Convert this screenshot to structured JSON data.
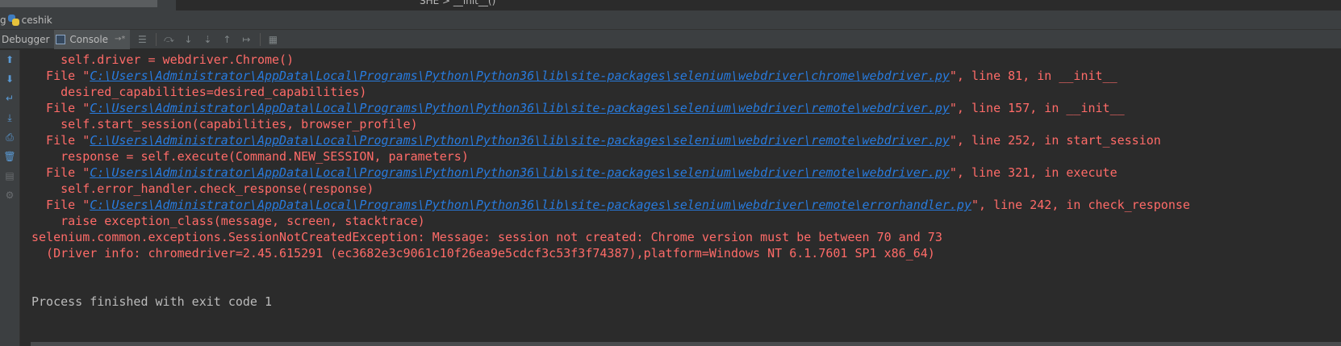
{
  "top": {
    "breadcrumb": "SHE  >  __init__()"
  },
  "run": {
    "lead_text": "g",
    "config_name": "ceshik"
  },
  "tabs": [
    {
      "label": "Debugger",
      "active": false
    },
    {
      "label": "Console",
      "active": true,
      "pin": "→*"
    }
  ],
  "console": {
    "lines": [
      {
        "kind": "code",
        "text": "    self.driver = webdriver.Chrome()"
      },
      {
        "kind": "file",
        "prefix": "  File \"",
        "path": "C:\\Users\\Administrator\\AppData\\Local\\Programs\\Python\\Python36\\lib\\site-packages\\selenium\\webdriver\\chrome\\webdriver.py",
        "suffix": "\", line 81, in __init__"
      },
      {
        "kind": "code",
        "text": "    desired_capabilities=desired_capabilities)"
      },
      {
        "kind": "file",
        "prefix": "  File \"",
        "path": "C:\\Users\\Administrator\\AppData\\Local\\Programs\\Python\\Python36\\lib\\site-packages\\selenium\\webdriver\\remote\\webdriver.py",
        "suffix": "\", line 157, in __init__"
      },
      {
        "kind": "code",
        "text": "    self.start_session(capabilities, browser_profile)"
      },
      {
        "kind": "file",
        "prefix": "  File \"",
        "path": "C:\\Users\\Administrator\\AppData\\Local\\Programs\\Python\\Python36\\lib\\site-packages\\selenium\\webdriver\\remote\\webdriver.py",
        "suffix": "\", line 252, in start_session"
      },
      {
        "kind": "code",
        "text": "    response = self.execute(Command.NEW_SESSION, parameters)"
      },
      {
        "kind": "file",
        "prefix": "  File \"",
        "path": "C:\\Users\\Administrator\\AppData\\Local\\Programs\\Python\\Python36\\lib\\site-packages\\selenium\\webdriver\\remote\\webdriver.py",
        "suffix": "\", line 321, in execute"
      },
      {
        "kind": "code",
        "text": "    self.error_handler.check_response(response)"
      },
      {
        "kind": "file",
        "prefix": "  File \"",
        "path": "C:\\Users\\Administrator\\AppData\\Local\\Programs\\Python\\Python36\\lib\\site-packages\\selenium\\webdriver\\remote\\errorhandler.py",
        "suffix": "\", line 242, in check_response"
      },
      {
        "kind": "code",
        "text": "    raise exception_class(message, screen, stacktrace)"
      },
      {
        "kind": "code",
        "text": "selenium.common.exceptions.SessionNotCreatedException: Message: session not created: Chrome version must be between 70 and 73"
      },
      {
        "kind": "code",
        "text": "  (Driver info: chromedriver=2.45.615291 (ec3682e3c9061c10f26ea9e5cdcf3c53f3f74387),platform=Windows NT 6.1.7601 SP1 x86_64)"
      },
      {
        "kind": "blank",
        "text": ""
      },
      {
        "kind": "blank",
        "text": ""
      },
      {
        "kind": "normal",
        "text": "Process finished with exit code 1"
      }
    ]
  },
  "colors": {
    "background": "#2b2b2b",
    "error_text": "#ff6b68",
    "link": "#287bde",
    "normal_text": "#bbbbbb"
  }
}
